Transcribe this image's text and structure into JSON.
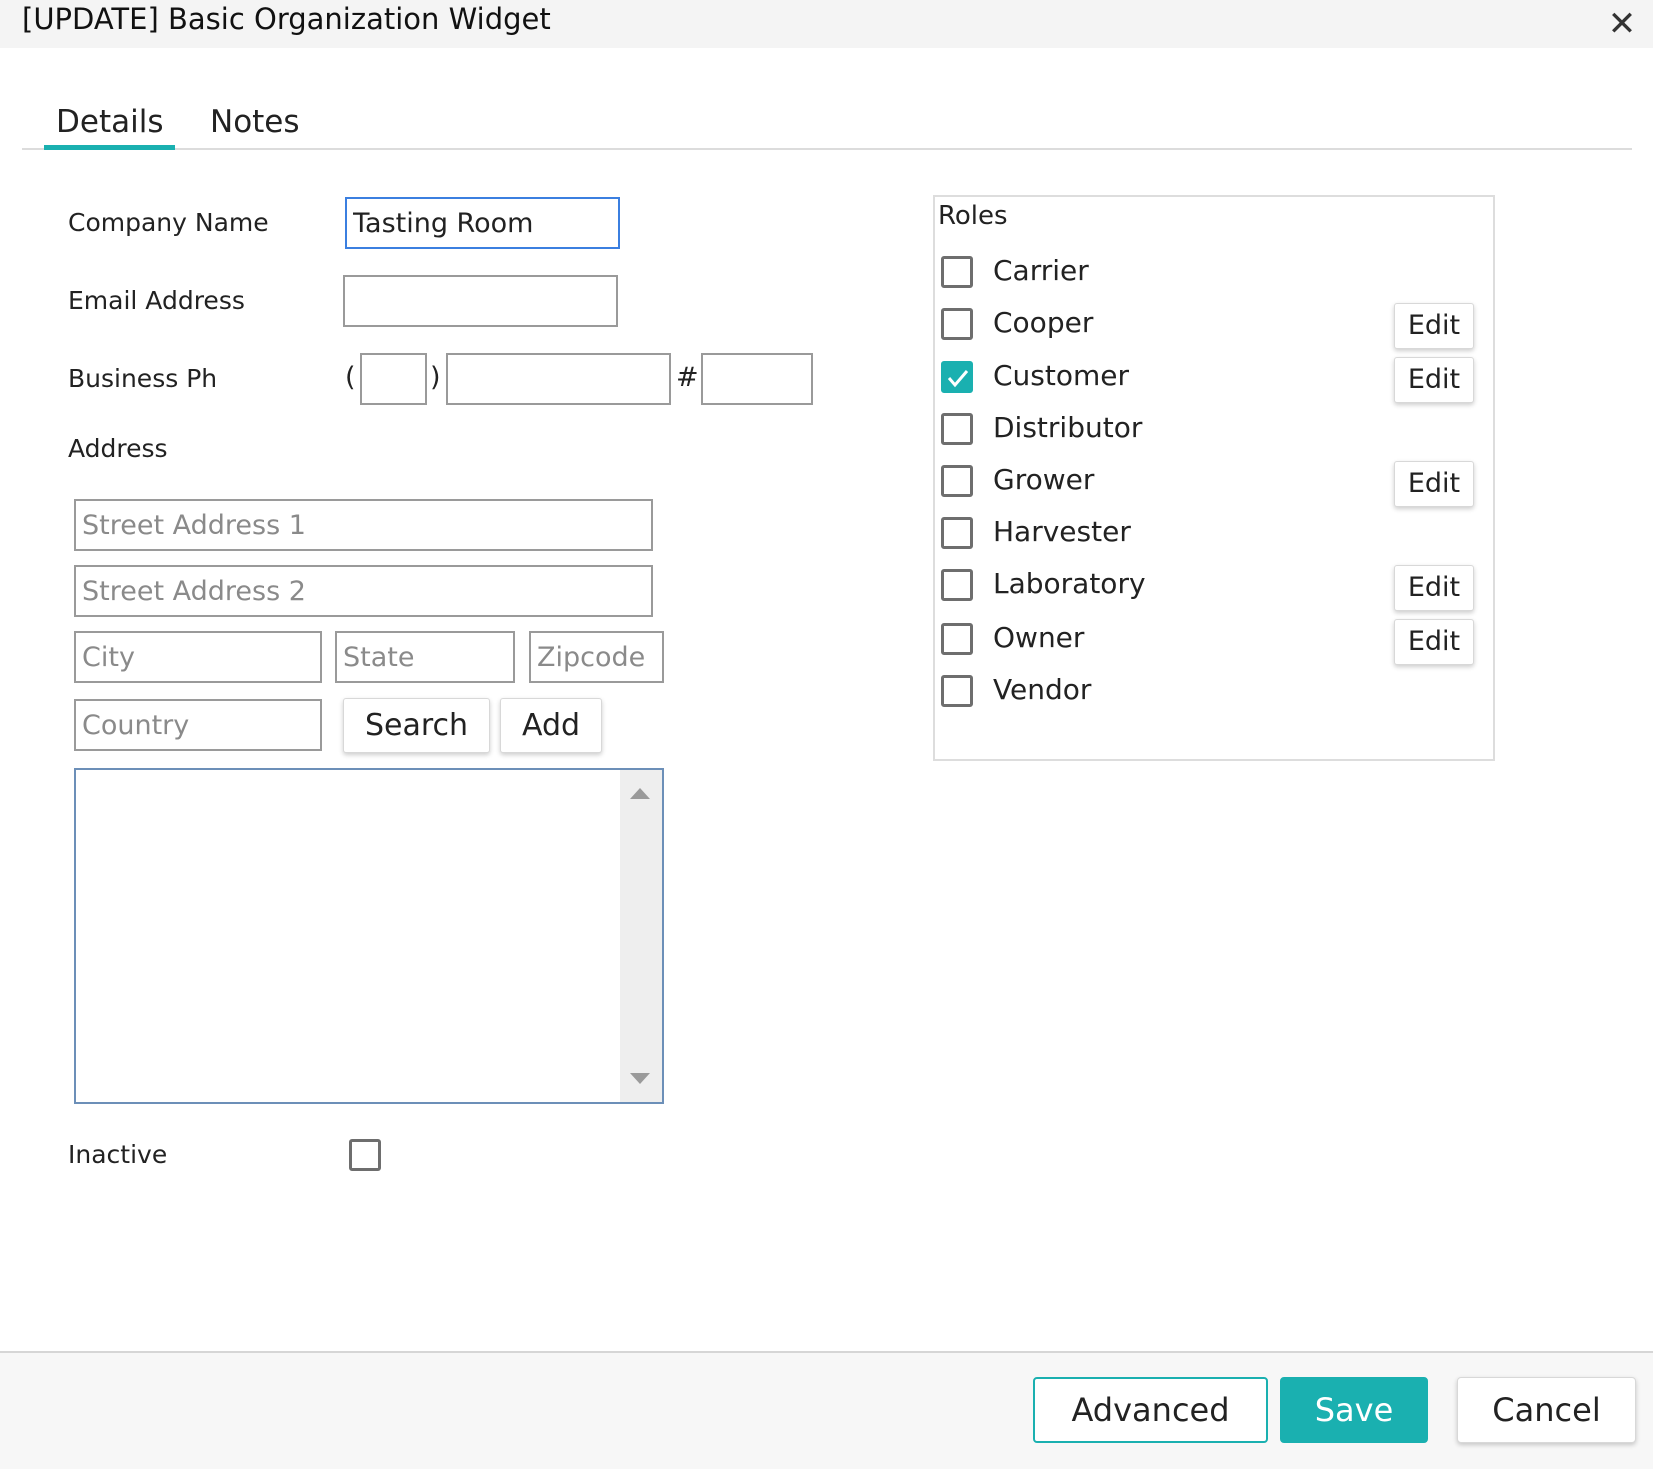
{
  "window": {
    "title": "[UPDATE] Basic Organization Widget",
    "close_icon": "close-icon"
  },
  "tabs": [
    {
      "label": "Details",
      "active": true
    },
    {
      "label": "Notes",
      "active": false
    }
  ],
  "form": {
    "company_name_label": "Company Name",
    "company_name_value": "Tasting Room",
    "email_label": "Email Address",
    "email_value": "",
    "phone_label": "Business Ph",
    "phone_open_paren": "(",
    "phone_close_paren": ")",
    "phone_ext_symbol": "#",
    "address_label": "Address",
    "street1_placeholder": "Street Address 1",
    "street2_placeholder": "Street Address 2",
    "city_placeholder": "City",
    "state_placeholder": "State",
    "zipcode_placeholder": "Zipcode",
    "country_placeholder": "Country",
    "search_label": "Search",
    "add_label": "Add",
    "inactive_label": "Inactive",
    "inactive_checked": false
  },
  "roles": {
    "title": "Roles",
    "items": [
      {
        "label": "Carrier",
        "checked": false,
        "edit": ""
      },
      {
        "label": "Cooper",
        "checked": false,
        "edit": "Edit"
      },
      {
        "label": "Customer",
        "checked": true,
        "edit": "Edit"
      },
      {
        "label": "Distributor",
        "checked": false,
        "edit": ""
      },
      {
        "label": "Grower",
        "checked": false,
        "edit": "Edit"
      },
      {
        "label": "Harvester",
        "checked": false,
        "edit": ""
      },
      {
        "label": "Laboratory",
        "checked": false,
        "edit": "Edit"
      },
      {
        "label": "Owner",
        "checked": false,
        "edit": "Edit"
      },
      {
        "label": "Vendor",
        "checked": false,
        "edit": ""
      }
    ]
  },
  "footer": {
    "advanced_label": "Advanced",
    "save_label": "Save",
    "cancel_label": "Cancel"
  },
  "colors": {
    "accent": "#1ab0b0",
    "focus_border": "#3b7fe0"
  }
}
